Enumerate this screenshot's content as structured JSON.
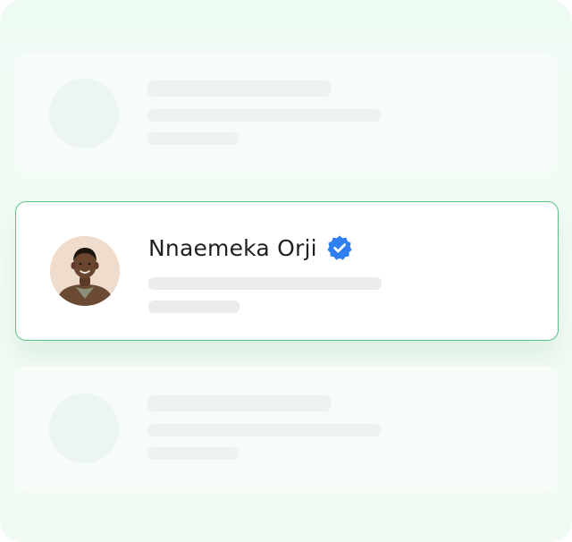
{
  "profile": {
    "name": "Nnaemeka Orji",
    "verified": true,
    "verified_icon": "verified-badge-icon",
    "avatar_icon": "user-portrait-avatar"
  },
  "colors": {
    "accent_border": "#5cc187",
    "verified_badge": "#2f7ff0",
    "background": "#eefbf3",
    "skeleton_bar": "#ececef"
  }
}
